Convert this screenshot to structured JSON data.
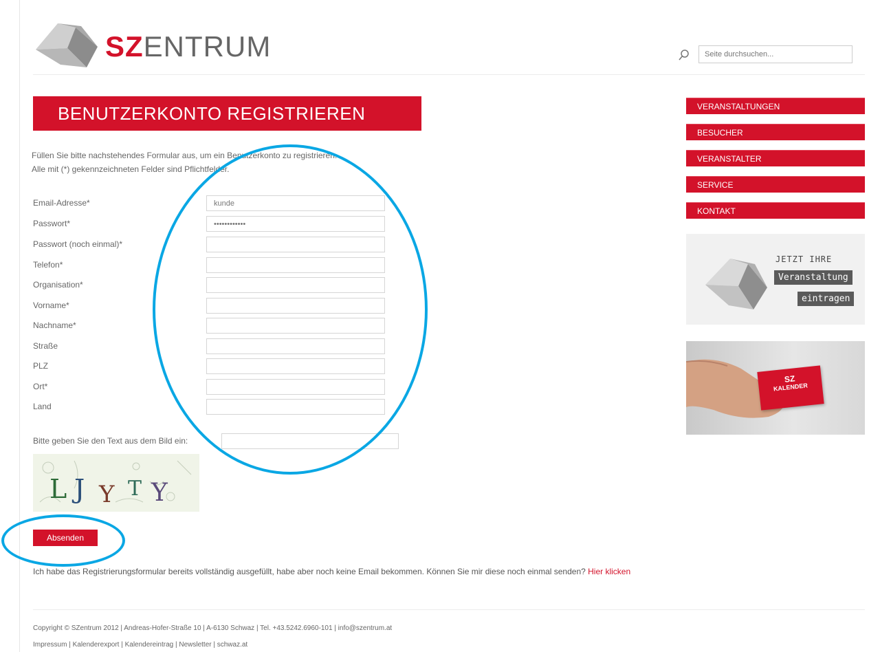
{
  "header": {
    "logo_bold": "SZ",
    "logo_rest": "ENTRUM",
    "search_placeholder": "Seite durchsuchen..."
  },
  "main": {
    "title": "BENUTZERKONTO REGISTRIEREN",
    "intro_line1": "Füllen Sie bitte nachstehendes Formular aus, um ein Benutzerkonto zu registrieren.",
    "intro_line2": "Alle mit (*) gekennzeichneten Felder sind Pflichtfelder.",
    "fields": [
      {
        "label": "Email-Adresse*",
        "value": "kunde"
      },
      {
        "label": "Passwort*",
        "value": "••••••••••••"
      },
      {
        "label": "Passwort (noch einmal)*",
        "value": ""
      },
      {
        "label": "Telefon*",
        "value": ""
      },
      {
        "label": "Organisation*",
        "value": ""
      },
      {
        "label": "Vorname*",
        "value": ""
      },
      {
        "label": "Nachname*",
        "value": ""
      },
      {
        "label": "Straße",
        "value": ""
      },
      {
        "label": "PLZ",
        "value": ""
      },
      {
        "label": "Ort*",
        "value": ""
      },
      {
        "label": "Land",
        "value": ""
      }
    ],
    "captcha_label": "Bitte geben Sie den Text aus dem Bild ein:",
    "captcha_text": "LJYTY",
    "submit_label": "Absenden",
    "resend_text": "Ich habe das Registrierungsformular bereits vollständig ausgefüllt, habe aber noch keine Email bekommen. Können Sie mir diese noch einmal senden?",
    "resend_link": "Hier klicken"
  },
  "sidebar": {
    "nav": [
      "VERANSTALTUNGEN",
      "BESUCHER",
      "VERANSTALTER",
      "SERVICE",
      "KONTAKT"
    ],
    "promo_jetzt": "JETZT IHRE",
    "promo_tag1": "Veranstaltung",
    "promo_tag2": "eintragen",
    "card_line1": "SZ",
    "card_line2": "KALENDER"
  },
  "footer": {
    "line1": "Copyright © SZentrum 2012 | Andreas-Hofer-Straße 10 | A-6130 Schwaz | Tel. +43.5242.6960-101 | info@szentrum.at",
    "line2": "Impressum | Kalenderexport | Kalendereintrag | Newsletter | schwaz.at"
  },
  "colors": {
    "brand_red": "#d3122a",
    "annotation_blue": "#0aa7e4"
  }
}
